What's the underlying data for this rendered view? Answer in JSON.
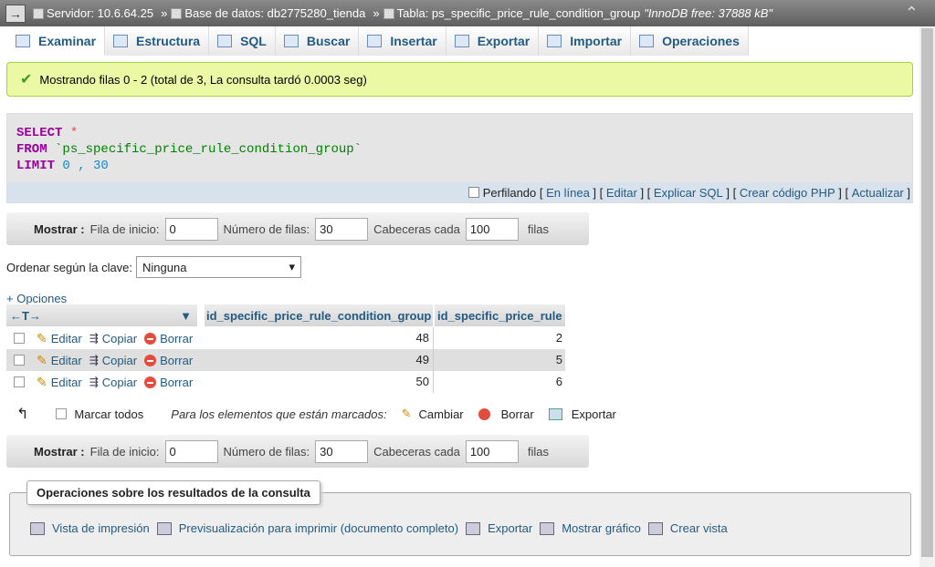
{
  "breadcrumb": {
    "arrow": "→",
    "server": "Servidor: 10.6.64.25",
    "database": "Base de datos: db2775280_tienda",
    "table": "Tabla: ps_specific_price_rule_condition_group",
    "innodb": "\"InnoDB free: 37888 kB\"",
    "sep": "»"
  },
  "tabs": [
    {
      "label": "Examinar",
      "icon": "browse-icon"
    },
    {
      "label": "Estructura",
      "icon": "structure-icon"
    },
    {
      "label": "SQL",
      "icon": "sql-icon"
    },
    {
      "label": "Buscar",
      "icon": "search-icon"
    },
    {
      "label": "Insertar",
      "icon": "insert-icon"
    },
    {
      "label": "Exportar",
      "icon": "export-icon"
    },
    {
      "label": "Importar",
      "icon": "import-icon"
    },
    {
      "label": "Operaciones",
      "icon": "wrench-icon"
    }
  ],
  "success_message": "Mostrando filas 0 - 2 (total de 3, La consulta tardó 0.0003 seg)",
  "sql": {
    "select": "SELECT",
    "star": "*",
    "from": "FROM",
    "table": "`ps_specific_price_rule_condition_group`",
    "limit": "LIMIT",
    "limit_vals": "0 , 30"
  },
  "sql_links": {
    "profiling": "Perfilando",
    "inline": "En línea",
    "edit": "Editar",
    "explain": "Explicar SQL",
    "php": "Crear código PHP",
    "refresh": "Actualizar"
  },
  "nav": {
    "show": "Mostrar :",
    "start_label": "Fila de inicio:",
    "start_value": "0",
    "rows_label": "Número de filas:",
    "rows_value": "30",
    "headers_label": "Cabeceras cada",
    "headers_value": "100",
    "rows_suffix": "filas"
  },
  "order": {
    "label": "Ordenar según la clave:",
    "value": "Ninguna"
  },
  "options_link": "+ Opciones",
  "table": {
    "nav_arrows": "←T→",
    "columns": [
      "id_specific_price_rule_condition_group",
      "id_specific_price_rule"
    ],
    "edit": "Editar",
    "copy": "Copiar",
    "delete": "Borrar",
    "rows": [
      {
        "c1": "48",
        "c2": "2"
      },
      {
        "c1": "49",
        "c2": "5"
      },
      {
        "c1": "50",
        "c2": "6"
      }
    ]
  },
  "bulk": {
    "check_all": "Marcar todos",
    "with_selected": "Para los elementos que están marcados:",
    "change": "Cambiar",
    "delete": "Borrar",
    "export": "Exportar"
  },
  "ops": {
    "title": "Operaciones sobre los resultados de la consulta",
    "print": "Vista de impresión",
    "print_full": "Previsualización para imprimir (documento completo)",
    "export": "Exportar",
    "chart": "Mostrar gráfico",
    "view": "Crear vista"
  }
}
